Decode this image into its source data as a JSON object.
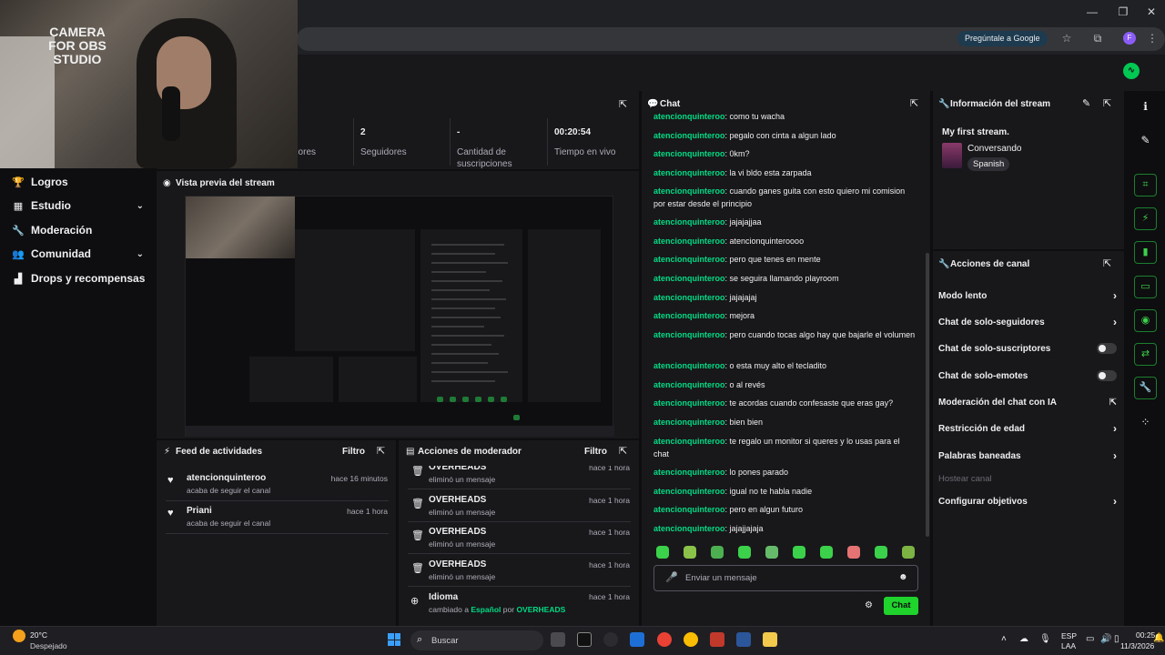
{
  "webcam": {
    "label": "CAMERA FOR OBS STUDIO"
  },
  "browser": {
    "ask_google": "Pregúntale a Google",
    "profile_initial": "F"
  },
  "sidebar": {
    "items": [
      {
        "label": "Logros",
        "icon": "trophy-icon",
        "has_chevron": false
      },
      {
        "label": "Estudio",
        "icon": "grid-icon",
        "has_chevron": true
      },
      {
        "label": "Moderación",
        "icon": "wrench-icon",
        "has_chevron": false
      },
      {
        "label": "Comunidad",
        "icon": "people-icon",
        "has_chevron": true
      },
      {
        "label": "Drops y recompensas",
        "icon": "chart-icon",
        "has_chevron": false
      }
    ]
  },
  "stats": {
    "items": [
      {
        "value": "",
        "label": "dores"
      },
      {
        "value": "2",
        "label": "Seguidores"
      },
      {
        "value": "-",
        "label": "Cantidad de suscripciones"
      },
      {
        "value": "00:20:54",
        "label": "Tiempo en vivo"
      }
    ]
  },
  "preview": {
    "title": "Vista previa del stream"
  },
  "activity_feed": {
    "title": "Feed de actividades",
    "filter": "Filtro",
    "items": [
      {
        "name": "atencionquinteroo",
        "sub": "acaba de seguir el canal",
        "time": "hace 16 minutos"
      },
      {
        "name": "Priani",
        "sub": "acaba de seguir el canal",
        "time": "hace 1 hora"
      }
    ]
  },
  "mod_actions": {
    "title": "Acciones de moderador",
    "filter": "Filtro",
    "items": [
      {
        "name": "OVERHEADS",
        "sub": "eliminó un mensaje",
        "time": "hace 1 hora"
      },
      {
        "name": "OVERHEADS",
        "sub": "eliminó un mensaje",
        "time": "hace 1 hora"
      },
      {
        "name": "OVERHEADS",
        "sub": "eliminó un mensaje",
        "time": "hace 1 hora"
      },
      {
        "name": "OVERHEADS",
        "sub": "eliminó un mensaje",
        "time": "hace 1 hora"
      }
    ],
    "language": {
      "name": "Idioma",
      "prefix": "cambiado a",
      "lang": "Español",
      "by": "por",
      "user": "OVERHEADS",
      "time": "hace 1 hora"
    }
  },
  "chat": {
    "title": "Chat",
    "messages": [
      {
        "user": "atencionquinteroo",
        "text": ": como tu wacha"
      },
      {
        "user": "atencionquinteroo",
        "text": ": pegalo con cinta a algun lado"
      },
      {
        "user": "atencionquinteroo",
        "text": ": 0km?"
      },
      {
        "user": "atencionquinteroo",
        "text": ": la vi bldo esta zarpada"
      },
      {
        "user": "atencionquinteroo",
        "text": ": cuando ganes guita con esto quiero mi comision por estar desde el principio"
      },
      {
        "user": "atencionquinteroo",
        "text": ": jajajajjaa"
      },
      {
        "user": "atencionquinteroo",
        "text": ": atencionquinteroooo"
      },
      {
        "user": "atencionquinteroo",
        "text": ": pero que tenes en mente"
      },
      {
        "user": "atencionquinteroo",
        "text": ": se seguira llamando playroom"
      },
      {
        "user": "atencionquinteroo",
        "text": ": jajajajaj"
      },
      {
        "user": "atencionquinteroo",
        "text": ": mejora"
      },
      {
        "user": "atencionquinteroo",
        "text": ": pero cuando tocas algo hay que bajarle el volumen"
      },
      {
        "user": "atencionquinteroo",
        "text": ": o esta muy alto el tecladito"
      },
      {
        "user": "atencionquinteroo",
        "text": ": o al revés"
      },
      {
        "user": "atencionquinteroo",
        "text": ": te acordas cuando confesaste que eras gay?"
      },
      {
        "user": "atencionquinteroo",
        "text": ": bien bien"
      },
      {
        "user": "atencionquinteroo",
        "text": ": te regalo un monitor si queres y lo usas para el chat"
      },
      {
        "user": "atencionquinteroo",
        "text": ": lo pones parado"
      },
      {
        "user": "atencionquinteroo",
        "text": ": igual no te habla nadie"
      },
      {
        "user": "atencionquinteroo",
        "text": ": pero en algun futuro"
      },
      {
        "user": "atencionquinteroo",
        "text": ": jajajjajaja"
      }
    ],
    "input_placeholder": "Enviar un mensaje",
    "send_label": "Chat"
  },
  "stream_info": {
    "title": "Información del stream",
    "stream_title": "My first stream.",
    "category": "Conversando",
    "tag": "Spanish"
  },
  "channel_actions": {
    "title": "Acciones de canal",
    "items": [
      {
        "label": "Modo lento",
        "control": "chevron"
      },
      {
        "label": "Chat de solo-seguidores",
        "control": "chevron"
      },
      {
        "label": "Chat de solo-suscriptores",
        "control": "toggle"
      },
      {
        "label": "Chat de solo-emotes",
        "control": "toggle"
      },
      {
        "label": "Moderación del chat con IA",
        "control": "popout"
      },
      {
        "label": "Restricción de edad",
        "control": "chevron"
      },
      {
        "label": "Palabras baneadas",
        "control": "chevron"
      },
      {
        "label": "Hostear canal",
        "control": "disabled"
      },
      {
        "label": "Configurar objetivos",
        "control": "chevron"
      }
    ]
  },
  "taskbar": {
    "weather_temp": "20°C",
    "weather_desc": "Despejado",
    "search_placeholder": "Buscar",
    "lang_top": "ESP",
    "lang_bottom": "LAA",
    "time": "00:25",
    "date": "11/3/2026"
  },
  "colors": {
    "accent_green": "#1fd32c",
    "chat_user": "#00db84",
    "panel_bg": "#18181b",
    "page_bg": "#0e0e10"
  }
}
